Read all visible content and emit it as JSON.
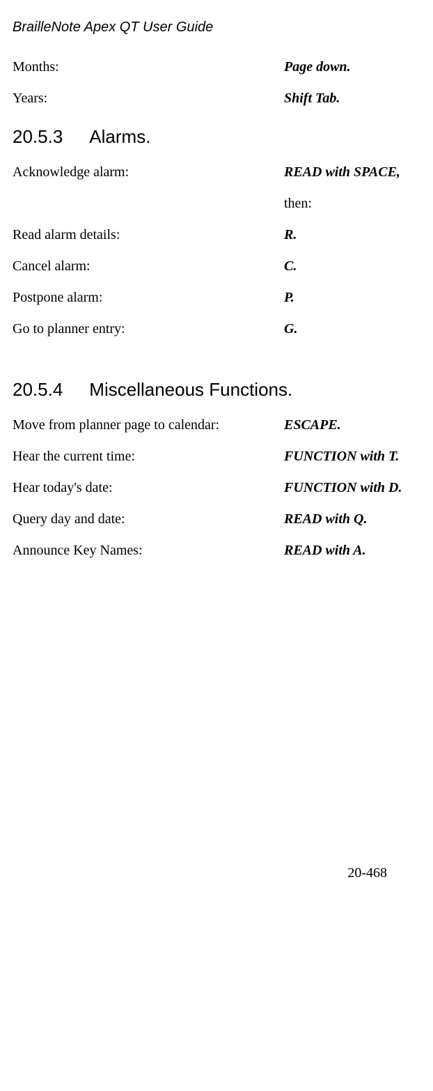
{
  "header": {
    "title": "BrailleNote Apex QT User Guide"
  },
  "intro_rows": [
    {
      "label": "Months:",
      "value": "Page down."
    },
    {
      "label": "Years:",
      "value": "Shift Tab."
    }
  ],
  "section_a": {
    "number": "20.5.3",
    "title": "Alarms.",
    "rows": [
      {
        "label": "Acknowledge alarm:",
        "value": "READ with SPACE,",
        "style": "italic-bold"
      },
      {
        "label": "",
        "value": "then:",
        "style": ""
      },
      {
        "label": "Read alarm details:",
        "value": "R.",
        "style": "italic-bold"
      },
      {
        "label": "Cancel alarm:",
        "value": "C.",
        "style": "italic-bold"
      },
      {
        "label": "Postpone alarm:",
        "value": "P.",
        "style": "italic-bold"
      },
      {
        "label": "Go to planner entry:",
        "value": "G.",
        "style": "italic-bold"
      }
    ]
  },
  "section_b": {
    "number": "20.5.4",
    "title": "Miscellaneous Functions.",
    "rows": [
      {
        "label": "Move from planner page to calendar:",
        "value": "ESCAPE.",
        "style": "italic-bold"
      },
      {
        "label": "Hear the current time:",
        "value": "FUNCTION with T.",
        "style": "italic-bold"
      },
      {
        "label": "Hear today's date:",
        "value": "FUNCTION with D.",
        "style": "italic-bold"
      },
      {
        "label": "Query day and date:",
        "value": "READ with Q.",
        "style": "italic-bold"
      },
      {
        "label": "Announce Key Names:",
        "value": "READ with A.",
        "style": "italic-bold"
      }
    ]
  },
  "footer": {
    "page": "20-468"
  }
}
